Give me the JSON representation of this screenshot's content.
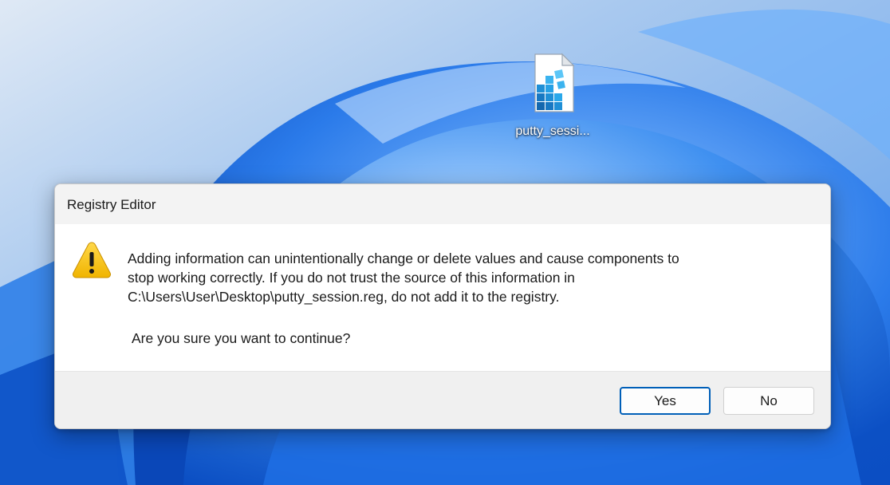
{
  "desktop": {
    "icon": {
      "label": "putty_sessi...",
      "icon": "registry-file-icon"
    }
  },
  "dialog": {
    "title": "Registry Editor",
    "icon": "warning-icon",
    "message_lines": [
      "Adding information can unintentionally change or delete values and cause components to",
      "stop working correctly. If you do not trust the source of this information in",
      "C:\\Users\\User\\Desktop\\putty_session.reg, do not add it to the registry."
    ],
    "question": "Are you sure you want to continue?",
    "buttons": {
      "yes": "Yes",
      "no": "No"
    }
  },
  "colors": {
    "accent": "#005fb8",
    "warning": "#f5c400",
    "wallpaper_light": "#cfe0f2",
    "wallpaper_blue": "#1f6fe0"
  }
}
